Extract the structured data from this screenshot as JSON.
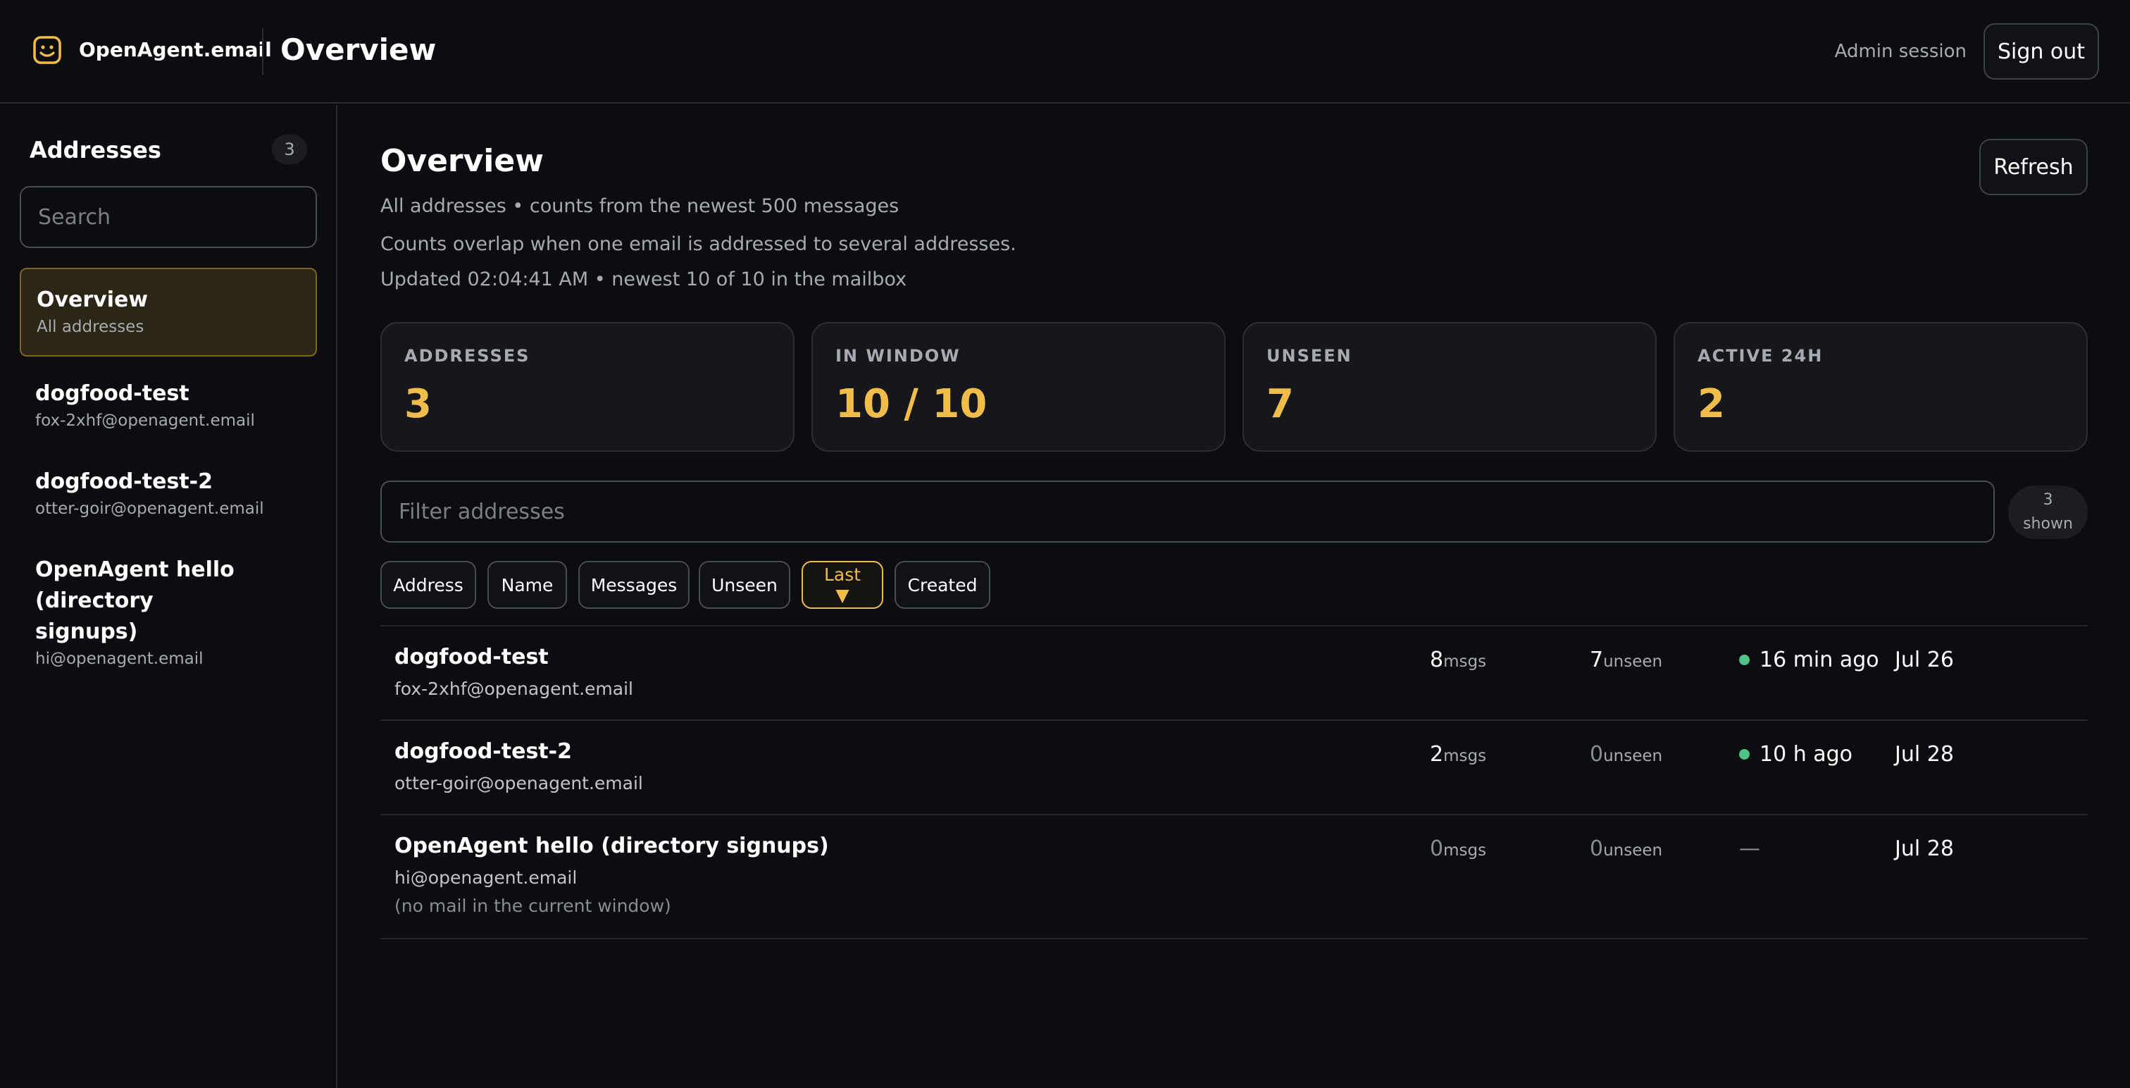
{
  "app": {
    "brand": "OpenAgent.email",
    "title": "Overview"
  },
  "header": {
    "admin_label": "Admin session",
    "signout_label": "Sign out"
  },
  "sidebar": {
    "title": "Addresses",
    "count": "3",
    "search_placeholder": "Search",
    "items": [
      {
        "name": "Overview",
        "sub": "All addresses",
        "active": true
      },
      {
        "name": "dogfood-test",
        "sub": "fox-2xhf@openagent.email"
      },
      {
        "name": "dogfood-test-2",
        "sub": "otter-goir@openagent.email"
      },
      {
        "name": "OpenAgent hello (directory signups)",
        "sub": "hi@openagent.email"
      }
    ]
  },
  "main": {
    "title": "Overview",
    "refresh_label": "Refresh",
    "subtitle": "All addresses • counts from the newest 500 messages",
    "note": "Counts overlap when one email is addressed to several addresses.",
    "updated": "Updated 02:04:41 AM • newest 10 of 10 in the mailbox",
    "stats": [
      {
        "label": "ADDRESSES",
        "value": "3"
      },
      {
        "label": "IN WINDOW",
        "value": "10 / 10"
      },
      {
        "label": "UNSEEN",
        "value": "7"
      },
      {
        "label": "ACTIVE 24H",
        "value": "2"
      }
    ],
    "filter_placeholder": "Filter addresses",
    "shown_count": "3",
    "shown_label": "shown",
    "sort_buttons": [
      "Address",
      "Name",
      "Messages",
      "Unseen",
      "Last ▼",
      "Created"
    ],
    "active_sort": "Last ▼",
    "rows": [
      {
        "name": "dogfood-test",
        "email": "fox-2xhf@openagent.email",
        "msgs": "8",
        "msgs_unit": "msgs",
        "unseen": "7",
        "unseen_unit": "unseen",
        "last": "16 min ago",
        "active": true,
        "created": "Jul 26"
      },
      {
        "name": "dogfood-test-2",
        "email": "otter-goir@openagent.email",
        "msgs": "2",
        "msgs_unit": "msgs",
        "unseen": "0",
        "unseen_unit": "unseen",
        "last": "10 h ago",
        "active": true,
        "created": "Jul 28"
      },
      {
        "name": "OpenAgent hello (directory signups)",
        "email": "hi@openagent.email",
        "note": "(no mail in the current window)",
        "msgs": "0",
        "msgs_unit": "msgs",
        "unseen": "0",
        "unseen_unit": "unseen",
        "last": "—",
        "active": false,
        "created": "Jul 28"
      }
    ]
  },
  "colors": {
    "accent": "#f1bd4a",
    "active_dot": "#4fc486",
    "background": "#0c0d10"
  },
  "icons": {
    "logo": "smiley-mail-icon",
    "status": "green-dot-icon"
  }
}
